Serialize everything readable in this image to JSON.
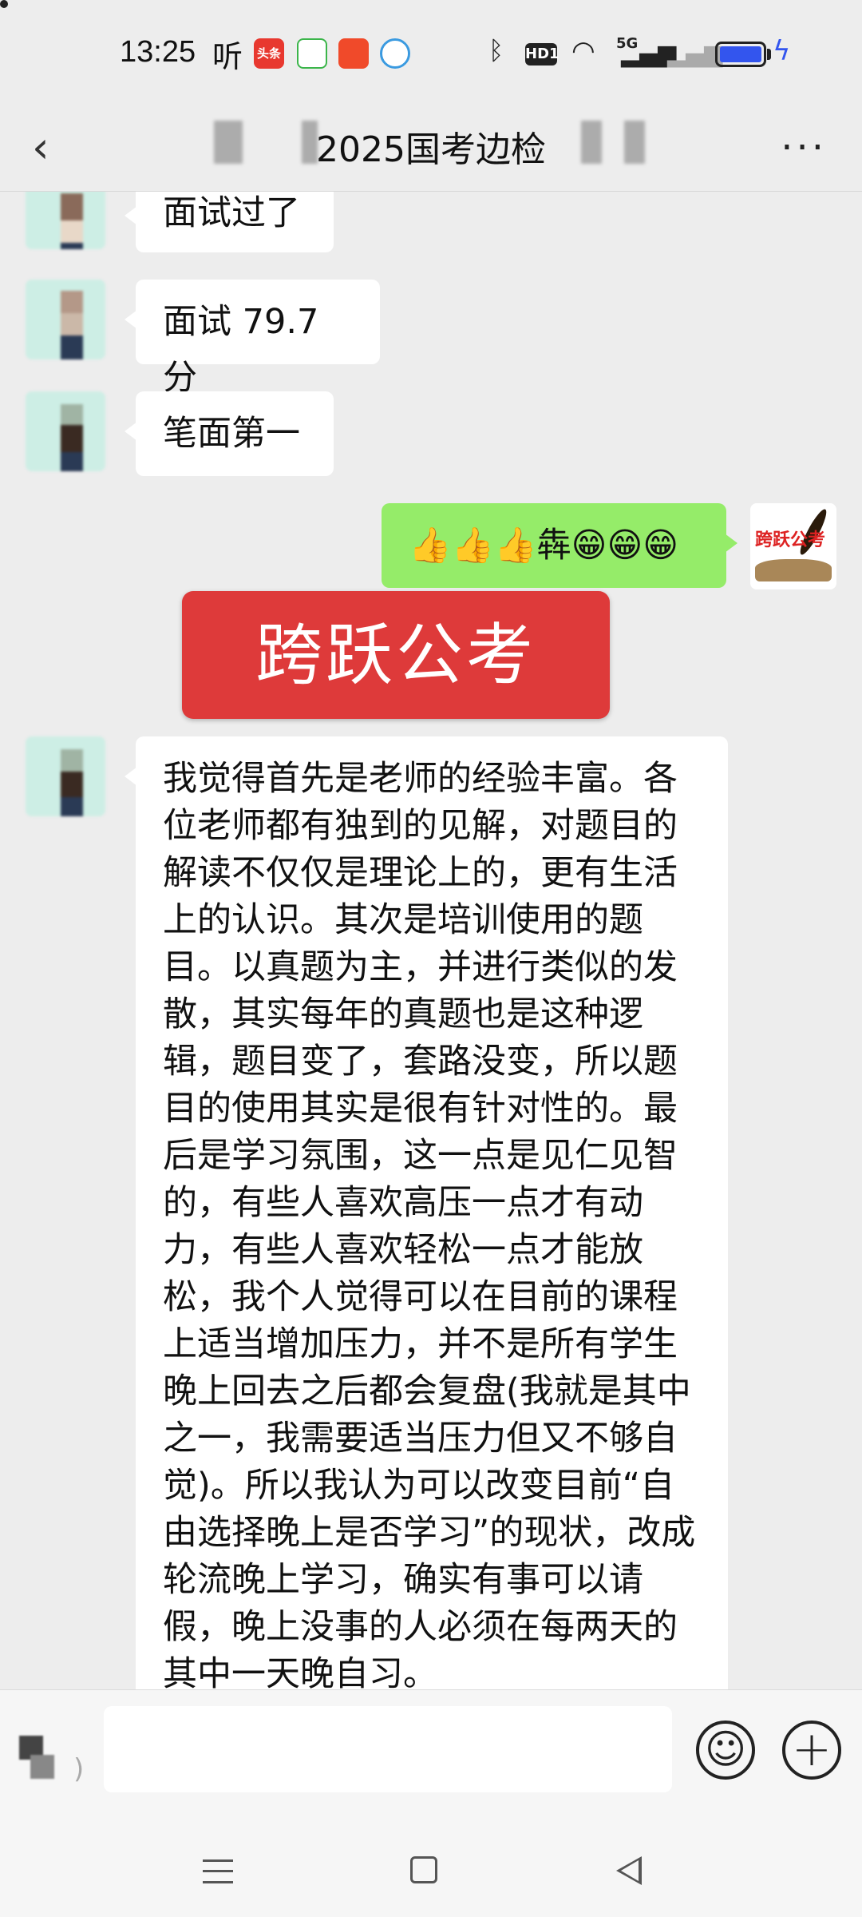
{
  "status_bar": {
    "time": "13:25",
    "ting_label": "听",
    "toutiao_label": "头条",
    "network": "5G",
    "hd": "HD1"
  },
  "header": {
    "back_icon": "‹",
    "title": "2025国考边检",
    "more_icon": "···"
  },
  "messages": [
    {
      "side": "left",
      "text": "面试过了"
    },
    {
      "side": "left",
      "text": "面试 79.7 分"
    },
    {
      "side": "left",
      "text": "笔面第一"
    },
    {
      "side": "right",
      "text": "👍👍👍犇😁😁😁"
    },
    {
      "side": "left",
      "text": "我觉得首先是老师的经验丰富。各位老师都有独到的见解，对题目的解读不仅仅是理论上的，更有生活上的认识。其次是培训使用的题目。以真题为主，并进行类似的发散，其实每年的真题也是这种逻辑，题目变了，套路没变，所以题目的使用其实是很有针对性的。最后是学习氛围，这一点是见仁见智的，有些人喜欢高压一点才有动力，有些人喜欢轻松一点才能放松，我个人觉得可以在目前的课程上适当增加压力，并不是所有学生晚上回去之后都会复盘(我就是其中之一，我需要适当压力但又不够自觉)。所以我认为可以改变目前“自由选择晚上是否学习”的现状，改成轮流晚上学习，确实有事可以请假，晚上没事的人必须在每两天的其中一天晚自习。"
    }
  ],
  "me_avatar_text": "跨跃公考",
  "overlay_text": "跨跃公考",
  "input_bar": {
    "emoji_icon": "☺",
    "plus_icon": "+"
  }
}
